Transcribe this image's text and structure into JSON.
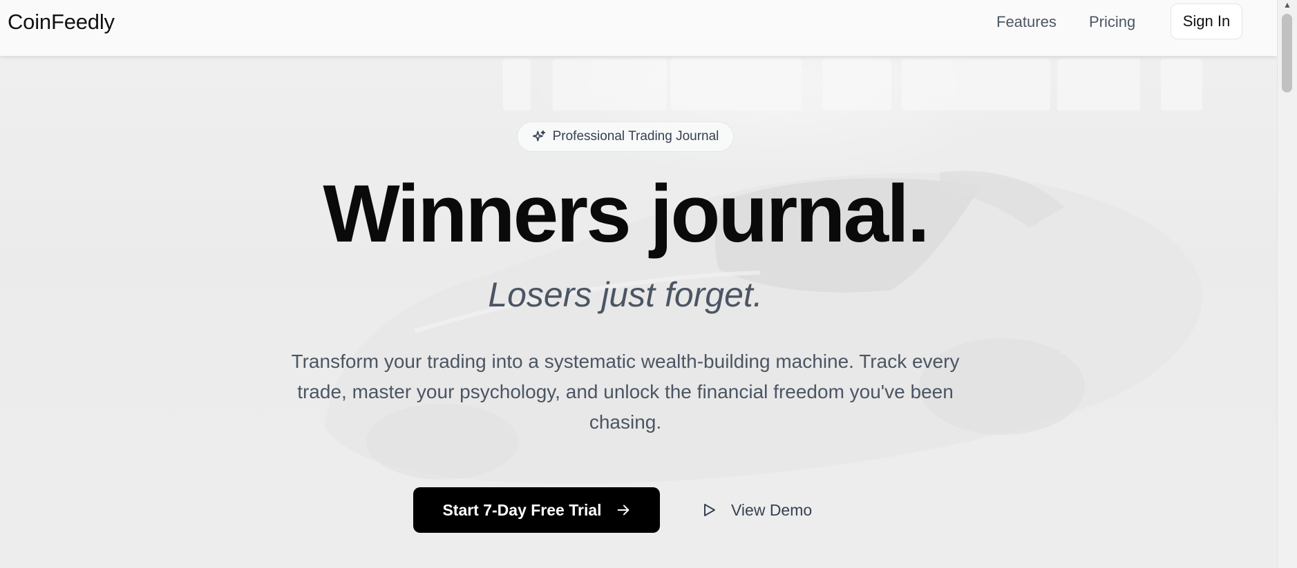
{
  "nav": {
    "logo": "CoinFeedly",
    "links": [
      {
        "label": "Features"
      },
      {
        "label": "Pricing"
      }
    ],
    "signin_label": "Sign In"
  },
  "hero": {
    "badge_icon": "sparkles-icon",
    "badge_text": "Professional Trading Journal",
    "headline": "Winners journal.",
    "subhead": "Losers just forget.",
    "description": "Transform your trading into a systematic wealth-building machine. Track every trade, master your psychology, and unlock the financial freedom you've been chasing.",
    "cta_label": "Start 7-Day Free Trial",
    "cta_icon": "arrow-right-icon",
    "demo_label": "View Demo",
    "demo_icon": "play-icon"
  },
  "colors": {
    "primary": "#000000",
    "text_muted": "#4b5563",
    "background": "#ebebeb"
  }
}
